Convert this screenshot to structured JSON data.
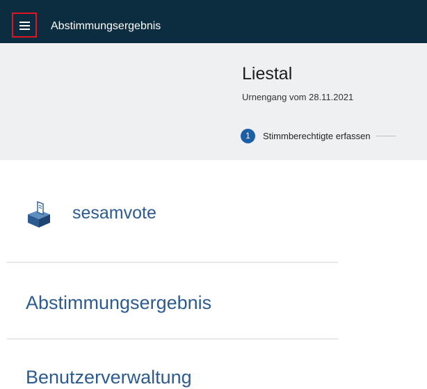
{
  "topbar": {
    "menu_icon": "hamburger-menu-icon",
    "title": "Abstimmungsergebnis"
  },
  "header": {
    "place": "Liestal",
    "subtitle": "Urnengang vom 28.11.2021",
    "steps": [
      {
        "number": "1",
        "label": "Stimmberechtigte erfassen"
      }
    ]
  },
  "nav": {
    "logo_icon": "ballot-box-icon",
    "brand": "sesamvote",
    "items": [
      {
        "label": "Abstimmungsergebnis"
      },
      {
        "label": "Benutzerverwaltung"
      }
    ]
  },
  "colors": {
    "topbar": "#0c2c3f",
    "header_bg": "#eef0f2",
    "accent": "#2c5b91",
    "step_badge": "#1b5fa8",
    "focus_outline": "#e0151f"
  }
}
